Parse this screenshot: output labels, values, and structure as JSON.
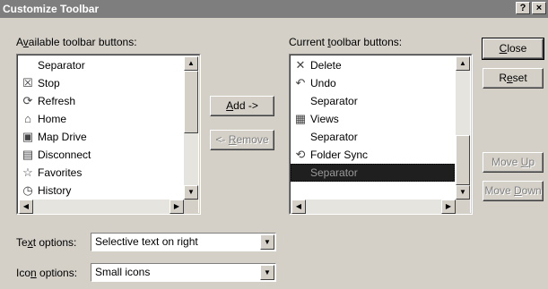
{
  "window": {
    "title": "Customize Toolbar",
    "help_label": "?",
    "close_label": "×"
  },
  "available": {
    "label_pre": "A",
    "label_accel": "v",
    "label_post": "ailable toolbar buttons:",
    "items": [
      {
        "label": "Separator",
        "icon": "none"
      },
      {
        "label": "Stop",
        "icon": "stop-icon"
      },
      {
        "label": "Refresh",
        "icon": "refresh-icon"
      },
      {
        "label": "Home",
        "icon": "home-icon"
      },
      {
        "label": "Map Drive",
        "icon": "map-drive-icon"
      },
      {
        "label": "Disconnect",
        "icon": "disconnect-icon"
      },
      {
        "label": "Favorites",
        "icon": "favorites-icon"
      },
      {
        "label": "History",
        "icon": "history-icon"
      }
    ]
  },
  "current": {
    "label_pre": "Current ",
    "label_accel": "t",
    "label_post": "oolbar buttons:",
    "items": [
      {
        "label": "Delete",
        "icon": "delete-icon"
      },
      {
        "label": "Undo",
        "icon": "undo-icon"
      },
      {
        "label": "Separator",
        "icon": "none"
      },
      {
        "label": "Views",
        "icon": "views-icon"
      },
      {
        "label": "Separator",
        "icon": "none"
      },
      {
        "label": "Folder Sync",
        "icon": "folder-sync-icon"
      },
      {
        "label": "Separator",
        "icon": "none",
        "selected": true
      }
    ]
  },
  "buttons": {
    "add_accel": "A",
    "add_post": "dd ->",
    "remove_pre": "<- ",
    "remove_accel": "R",
    "remove_post": "emove",
    "close_accel": "C",
    "close_post": "lose",
    "reset_pre": "R",
    "reset_accel": "e",
    "reset_post": "set",
    "move_up_pre": "Move ",
    "move_up_accel": "U",
    "move_up_post": "p",
    "move_down_pre": "Move ",
    "move_down_accel": "D",
    "move_down_post": "own"
  },
  "text_options": {
    "label_pre": "Te",
    "label_accel": "x",
    "label_post": "t options:",
    "value": "Selective text on right"
  },
  "icon_options": {
    "label_pre": "Ico",
    "label_accel": "n",
    "label_post": " options:",
    "value": "Small icons"
  },
  "icons": {
    "stop-icon": "☒",
    "refresh-icon": "⟳",
    "home-icon": "⌂",
    "map-drive-icon": "▣",
    "disconnect-icon": "▤",
    "favorites-icon": "☆",
    "history-icon": "◷",
    "delete-icon": "✕",
    "undo-icon": "↶",
    "views-icon": "▦",
    "folder-sync-icon": "⟲",
    "none": ""
  }
}
